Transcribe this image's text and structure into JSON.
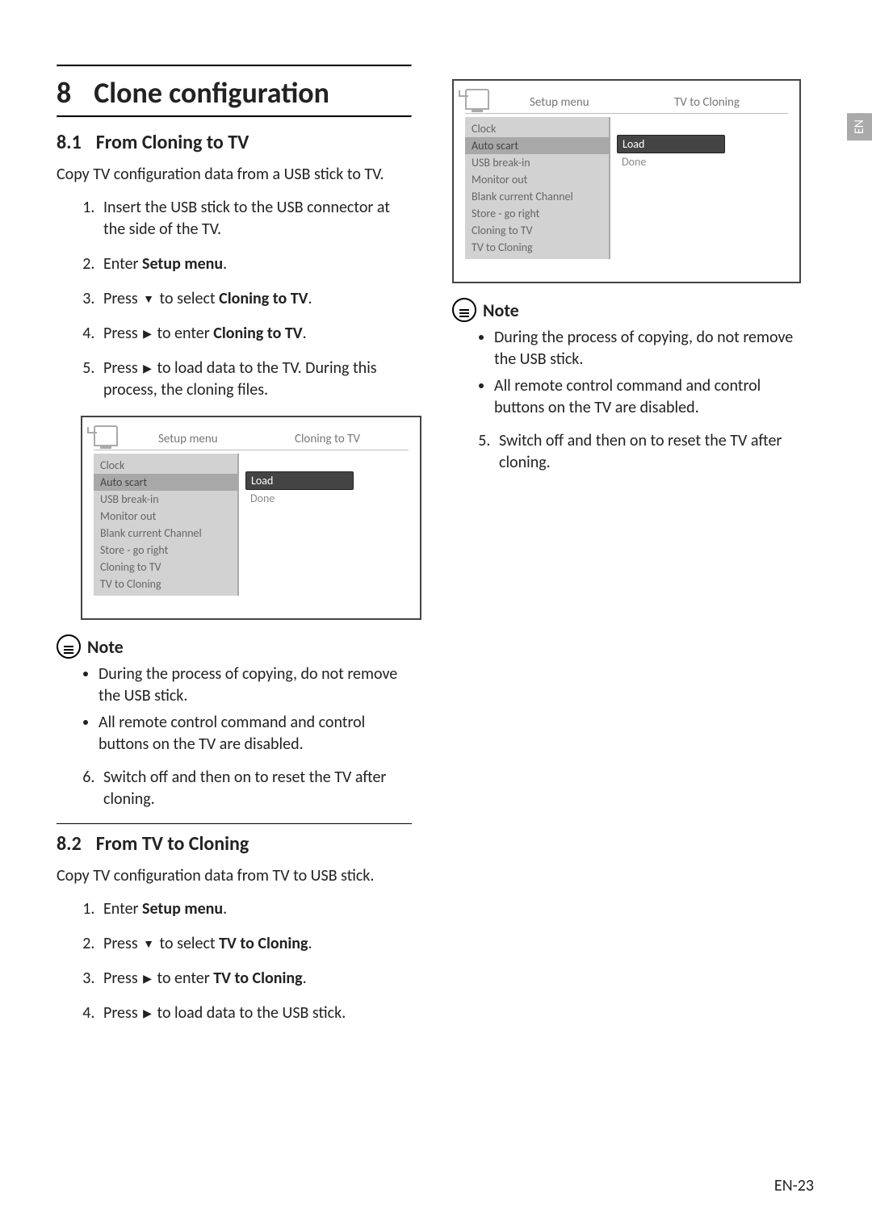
{
  "sideTab": "EN",
  "chapter": {
    "num": "8",
    "title": "Clone configuration"
  },
  "s81": {
    "num": "8.1",
    "title": "From Cloning to TV",
    "intro": "Copy TV configuration data from a USB stick to TV.",
    "step1": "Insert the USB stick to the USB connector at the side of the TV.",
    "step2a": "Enter ",
    "step2b": "Setup menu",
    "step2c": ".",
    "step3a": "Press ",
    "step3b": " to select ",
    "step3c": "Cloning to TV",
    "step3d": ".",
    "step4a": "Press ",
    "step4b": " to enter ",
    "step4c": "Cloning to TV",
    "step4d": ".",
    "step5a": "Press ",
    "step5b": " to load data to the TV. During this process, the cloning files.",
    "noteTitle": "Note",
    "noteA": "During the process of copying, do not remove the USB stick.",
    "noteB": "All remote control command and control buttons on the TV are disabled.",
    "step6": "Switch off and then on to reset the TV after cloning."
  },
  "s82": {
    "num": "8.2",
    "title": "From TV to Cloning",
    "intro": "Copy TV configuration data from TV to USB stick.",
    "step1a": "Enter ",
    "step1b": "Setup menu",
    "step1c": ".",
    "step2a": "Press ",
    "step2b": " to select ",
    "step2c": "TV to Cloning",
    "step2d": ".",
    "step3a": "Press ",
    "step3b": " to enter ",
    "step3c": "TV to Cloning",
    "step3d": ".",
    "step4a": "Press ",
    "step4b": " to load data to the USB stick.",
    "noteTitle": "Note",
    "noteA": "During the process of copying, do not remove the USB stick.",
    "noteB": "All remote control command and control buttons on the TV are disabled.",
    "step5": "Switch off and then on to reset the TV after cloning."
  },
  "tv1": {
    "h1": "Setup menu",
    "h2": "Cloning to TV",
    "left": [
      "Clock",
      "Auto scart",
      "USB break-in",
      "Monitor out",
      "Blank current Channel",
      "Store - go right",
      "Cloning to TV",
      "TV to Cloning"
    ],
    "right": [
      "Load",
      "Done"
    ]
  },
  "tv2": {
    "h1": "Setup menu",
    "h2": "TV to Cloning",
    "left": [
      "Clock",
      "Auto scart",
      "USB break-in",
      "Monitor out",
      "Blank current Channel",
      "Store - go right",
      "Cloning to TV",
      "TV to Cloning"
    ],
    "right": [
      "Load",
      "Done"
    ]
  },
  "footer": "EN-23"
}
